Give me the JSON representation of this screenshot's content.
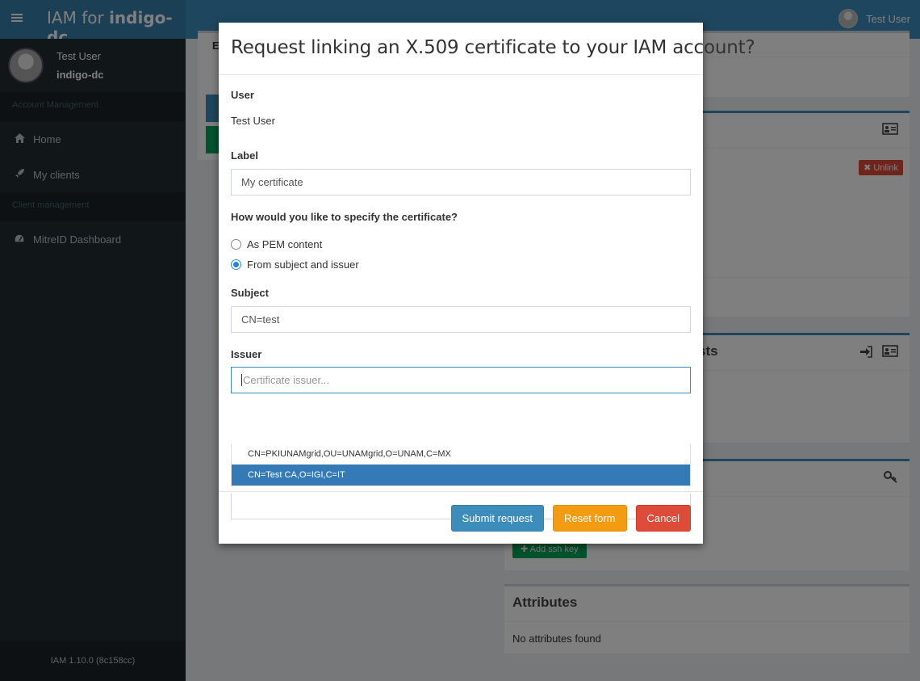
{
  "header": {
    "app_name_prefix": "IAM for ",
    "app_name_org": "indigo-dc",
    "user_name": "Test User"
  },
  "sidebar": {
    "user_name": "Test User",
    "user_org": "indigo-dc",
    "sections": [
      {
        "title": "Account Management",
        "items": [
          {
            "label": "Home",
            "icon": "home-icon"
          },
          {
            "label": "My clients",
            "icon": "rocket-icon"
          }
        ]
      },
      {
        "title": "Client management",
        "items": [
          {
            "label": "MitreID Dashboard",
            "icon": "dashboard-icon"
          }
        ]
      }
    ],
    "version": "IAM 1.10.0 (8c158cc)"
  },
  "background": {
    "groups_partial_title": "sts",
    "attributes_title": "Attributes",
    "attributes_empty": "No attributes found",
    "unlink_label": "Unlink",
    "add_ssh_label": "Add ssh key",
    "fragment_e": "E"
  },
  "modal": {
    "title": "Request linking an X.509 certificate to your IAM account?",
    "user_label": "User",
    "user_value": "Test User",
    "label_label": "Label",
    "label_value": "My certificate",
    "how_label": "How would you like to specify the certificate?",
    "options": [
      "As PEM content",
      "From subject and issuer"
    ],
    "selected_option": "From subject and issuer",
    "subject_label": "Subject",
    "subject_value": "CN=test",
    "issuer_label": "Issuer",
    "issuer_placeholder": "Certificate issuer...",
    "issuer_suggestions": [
      "CN=PKIUNAMgrid,OU=UNAMgrid,O=UNAM,C=MX",
      "CN=Test CA,O=IGI,C=IT"
    ],
    "highlighted_suggestion": "CN=Test CA,O=IGI,C=IT",
    "buttons": {
      "submit": "Submit request",
      "reset": "Reset form",
      "cancel": "Cancel"
    }
  }
}
